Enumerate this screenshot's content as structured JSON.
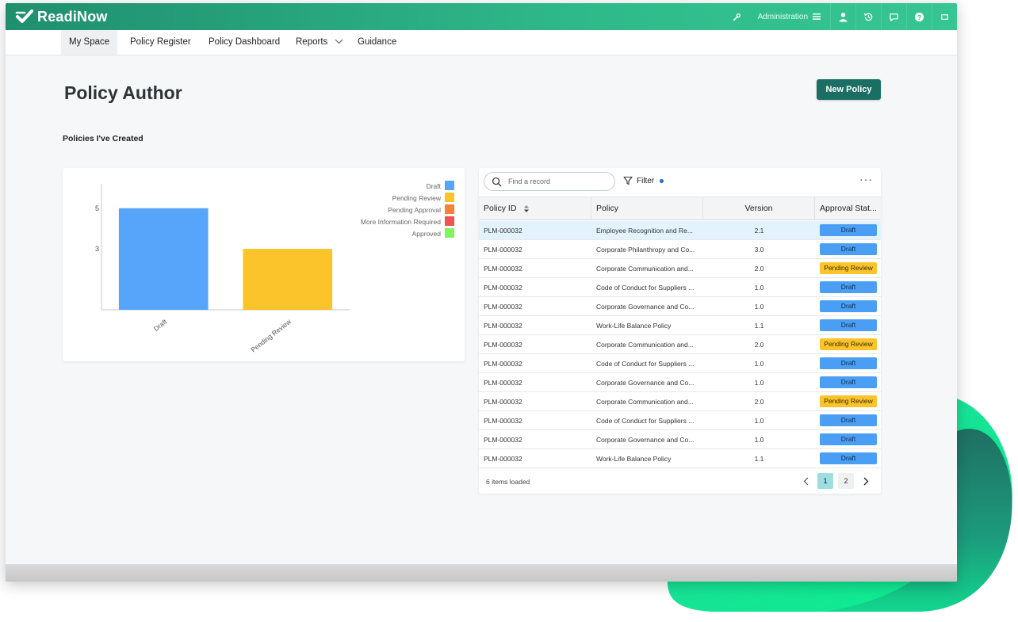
{
  "app": {
    "logo_text": "ReadiNow"
  },
  "topbar": {
    "admin_label": "Administration"
  },
  "nav": {
    "items": [
      "My Space",
      "Policy Register",
      "Policy Dashboard",
      "Reports",
      "Guidance"
    ]
  },
  "page": {
    "title": "Policy Author",
    "new_button": "New Policy",
    "section_title": "Policies I've Created"
  },
  "chart_data": {
    "type": "bar",
    "categories": [
      "Draft",
      "Pending Review"
    ],
    "values": [
      5,
      3
    ],
    "ylim": [
      0,
      6.2
    ],
    "yticks": [
      3,
      5
    ],
    "legend": [
      {
        "name": "Draft",
        "color": "#57a5fb"
      },
      {
        "name": "Pending Review",
        "color": "#fcc42b"
      },
      {
        "name": "Pending Approval",
        "color": "#f7803a"
      },
      {
        "name": "More Information Required",
        "color": "#f25252"
      },
      {
        "name": "Approved",
        "color": "#7ef55a"
      }
    ],
    "bar_colors": [
      "#57a5fb",
      "#fcc42b"
    ],
    "legend_position": "top-right",
    "grid": false
  },
  "table": {
    "search_placeholder": "Find a record",
    "filter_label": "Filter",
    "columns": [
      "Policy ID",
      "Policy",
      "Version",
      "Approval Stat..."
    ],
    "rows": [
      {
        "id": "PLM-000032",
        "policy": "Employee Recognition and Re...",
        "version": "2.1",
        "status": "Draft"
      },
      {
        "id": "PLM-000032",
        "policy": "Corporate Philanthropy and Co...",
        "version": "3.0",
        "status": "Draft"
      },
      {
        "id": "PLM-000032",
        "policy": "Corporate Communication and...",
        "version": "2.0",
        "status": "Pending Review"
      },
      {
        "id": "PLM-000032",
        "policy": "Code of Conduct for Suppliers ...",
        "version": "1.0",
        "status": "Draft"
      },
      {
        "id": "PLM-000032",
        "policy": "Corporate Governance and Co...",
        "version": "1.0",
        "status": "Draft"
      },
      {
        "id": "PLM-000032",
        "policy": "Work-Life Balance Policy",
        "version": "1.1",
        "status": "Draft"
      },
      {
        "id": "PLM-000032",
        "policy": "Corporate Communication and...",
        "version": "2.0",
        "status": "Pending Review"
      },
      {
        "id": "PLM-000032",
        "policy": "Code of Conduct for Suppliers ...",
        "version": "1.0",
        "status": "Draft"
      },
      {
        "id": "PLM-000032",
        "policy": "Corporate Governance and Co...",
        "version": "1.0",
        "status": "Draft"
      },
      {
        "id": "PLM-000032",
        "policy": "Corporate Communication and...",
        "version": "2.0",
        "status": "Pending Review"
      },
      {
        "id": "PLM-000032",
        "policy": "Code of Conduct for Suppliers ...",
        "version": "1.0",
        "status": "Draft"
      },
      {
        "id": "PLM-000032",
        "policy": "Corporate Governance and Co...",
        "version": "1.0",
        "status": "Draft"
      },
      {
        "id": "PLM-000032",
        "policy": "Work-Life Balance Policy",
        "version": "1.1",
        "status": "Draft"
      }
    ],
    "footer_text": "6 items loaded",
    "pages": [
      "1",
      "2"
    ],
    "current_page": "1"
  },
  "colors": {
    "brand": "#2fb98a",
    "button": "#1b6e63",
    "draft": "#4a9ff5",
    "review": "#fcc42b"
  }
}
